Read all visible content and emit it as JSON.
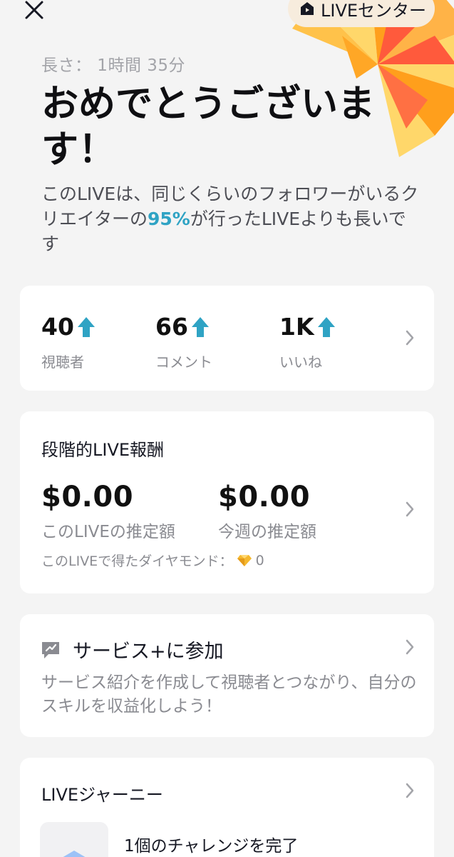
{
  "header": {
    "live_center_label": "LIVEセンター"
  },
  "summary": {
    "duration": "長さ： 1時間 35分",
    "headline": "おめでとうございます！",
    "subtitle_before": "このLIVEは、同じくらいのフォロワーがいるクリエイターの",
    "subtitle_pct": "95%",
    "subtitle_after": "が行ったLIVEよりも長いです"
  },
  "stats": [
    {
      "value": "40",
      "label": "視聴者"
    },
    {
      "value": "66",
      "label": "コメント"
    },
    {
      "value": "1K",
      "label": "いいね"
    }
  ],
  "rewards": {
    "title": "段階的LIVE報酬",
    "this_live_amount": "$0.00",
    "this_live_label": "このLIVEの推定額",
    "this_week_amount": "$0.00",
    "this_week_label": "今週の推定額",
    "diamonds_label": "このLIVEで得たダイヤモンド：",
    "diamonds_value": "0"
  },
  "service": {
    "title": "サービス+に参加",
    "description": "サービス紹介を作成して視聴者とつながり、自分のスキルを収益化しよう！"
  },
  "journey": {
    "title": "LIVEジャーニー",
    "item_label": "1個のチャレンジを完了"
  },
  "colors": {
    "accent_teal": "#2fa3c4",
    "burst_orange": "#ff9f1c",
    "burst_red": "#ff5a3c",
    "burst_yellow": "#ffd76a"
  },
  "icons": [
    "close-icon",
    "home-icon",
    "up-arrow-icon",
    "chevron-right-icon",
    "diamond-icon",
    "service-icon",
    "shield-badge-icon"
  ]
}
